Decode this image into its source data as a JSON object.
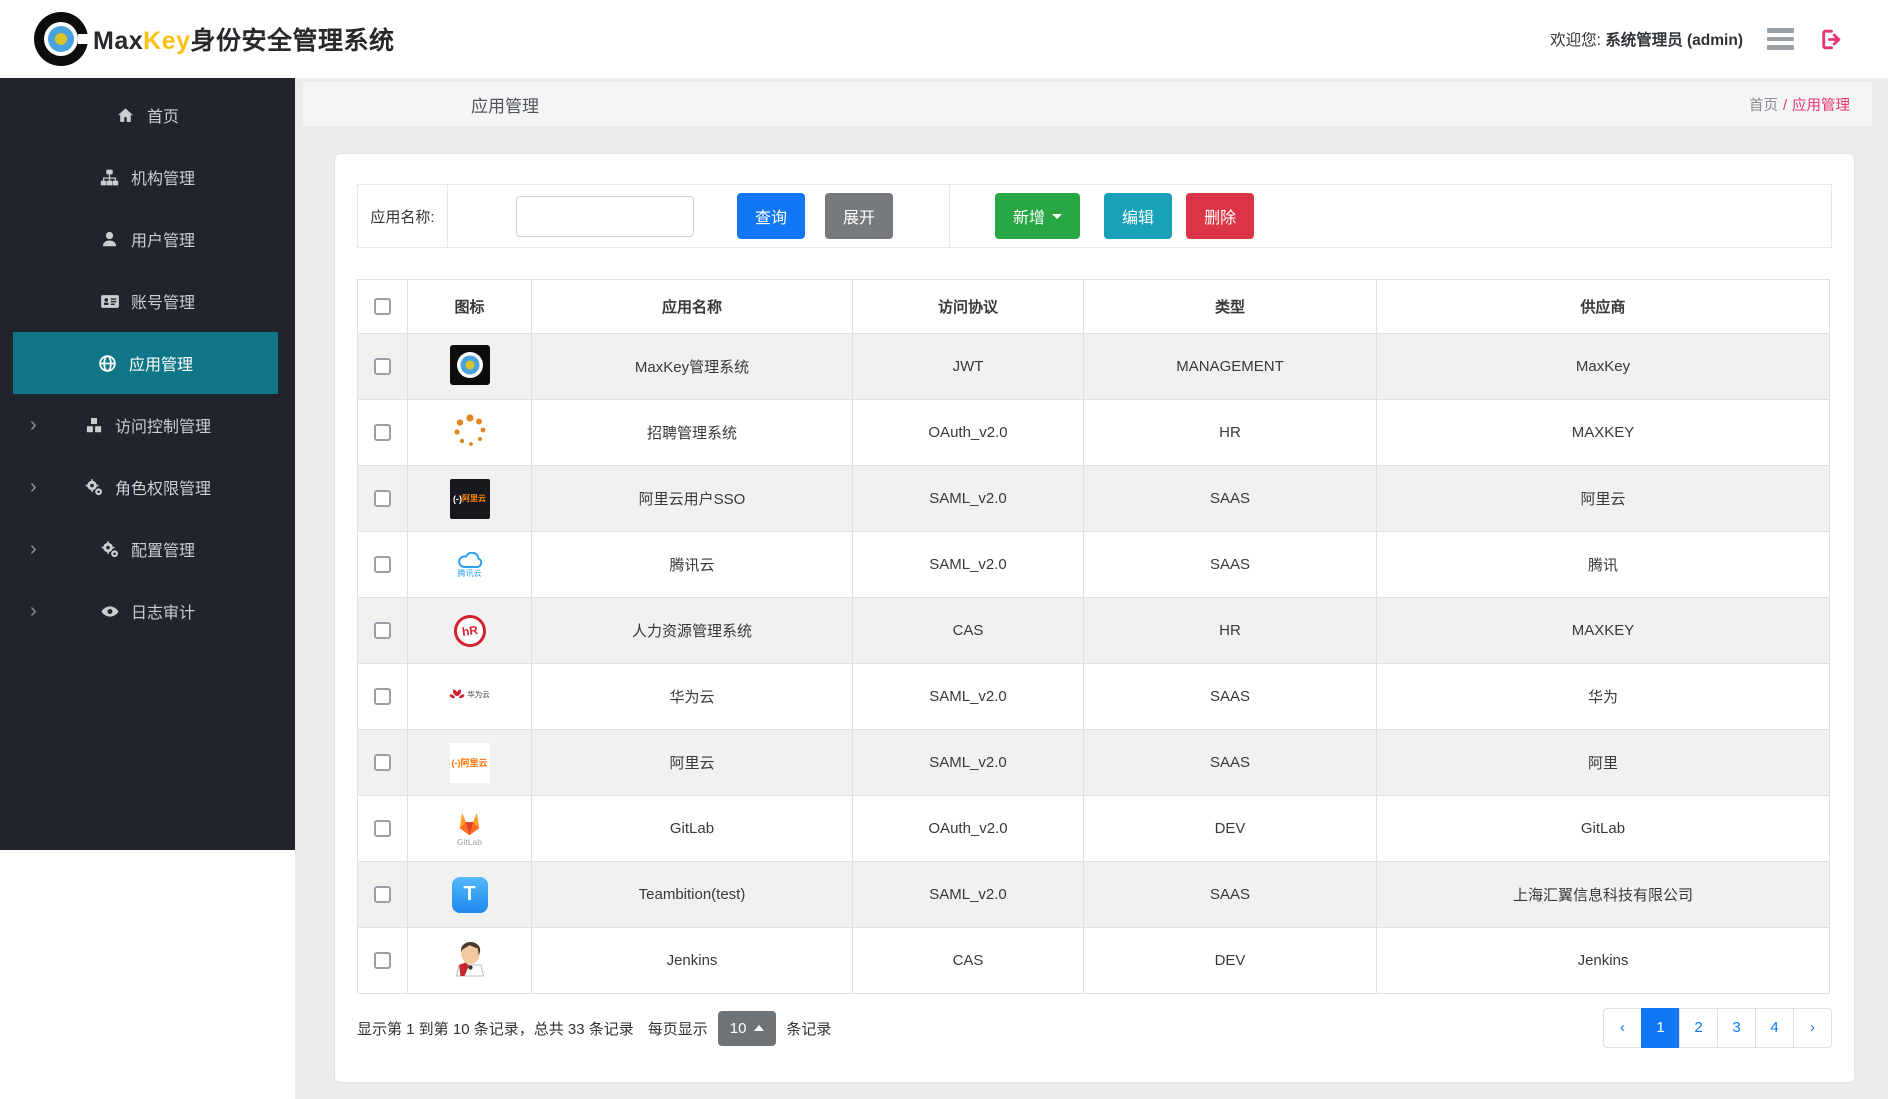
{
  "header": {
    "brand_prefix": "Max",
    "brand_accent": "Key",
    "brand_suffix": "身份安全管理系统",
    "welcome_label": "欢迎您:",
    "username": "系统管理员 (admin)"
  },
  "sidebar": {
    "items": [
      {
        "id": "home",
        "label": "首页",
        "icon": "home-icon",
        "active": false,
        "expandable": false
      },
      {
        "id": "org",
        "label": "机构管理",
        "icon": "sitemap-icon",
        "active": false,
        "expandable": false
      },
      {
        "id": "users",
        "label": "用户管理",
        "icon": "user-icon",
        "active": false,
        "expandable": false
      },
      {
        "id": "accounts",
        "label": "账号管理",
        "icon": "id-card-icon",
        "active": false,
        "expandable": false
      },
      {
        "id": "apps",
        "label": "应用管理",
        "icon": "globe-icon",
        "active": true,
        "expandable": false
      },
      {
        "id": "access-control",
        "label": "访问控制管理",
        "icon": "cubes-icon",
        "active": false,
        "expandable": true
      },
      {
        "id": "roles",
        "label": "角色权限管理",
        "icon": "gears-icon",
        "active": false,
        "expandable": true
      },
      {
        "id": "config",
        "label": "配置管理",
        "icon": "gears-icon",
        "active": false,
        "expandable": true
      },
      {
        "id": "audit",
        "label": "日志审计",
        "icon": "eye-icon",
        "active": false,
        "expandable": true
      }
    ]
  },
  "page": {
    "title": "应用管理",
    "breadcrumb": {
      "home": "首页",
      "separator": "/",
      "current": "应用管理"
    }
  },
  "toolbar": {
    "search_label": "应用名称:",
    "search_value": "",
    "query_label": "查询",
    "expand_label": "展开",
    "add_label": "新增",
    "edit_label": "编辑",
    "delete_label": "删除"
  },
  "table": {
    "columns": [
      "图标",
      "应用名称",
      "访问协议",
      "类型",
      "供应商"
    ],
    "rows": [
      {
        "icon": "maxkey-logo-icon",
        "name": "MaxKey管理系统",
        "protocol": "JWT",
        "type": "MANAGEMENT",
        "vendor": "MaxKey"
      },
      {
        "icon": "recruit-dots-icon",
        "name": "招聘管理系统",
        "protocol": "OAuth_v2.0",
        "type": "HR",
        "vendor": "MAXKEY"
      },
      {
        "icon": "aliyun-dark-icon",
        "name": "阿里云用户SSO",
        "protocol": "SAML_v2.0",
        "type": "SAAS",
        "vendor": "阿里云"
      },
      {
        "icon": "tencent-cloud-icon",
        "name": "腾讯云",
        "protocol": "SAML_v2.0",
        "type": "SAAS",
        "vendor": "腾讯"
      },
      {
        "icon": "hr-system-icon",
        "name": "人力资源管理系统",
        "protocol": "CAS",
        "type": "HR",
        "vendor": "MAXKEY"
      },
      {
        "icon": "huawei-cloud-icon",
        "name": "华为云",
        "protocol": "SAML_v2.0",
        "type": "SAAS",
        "vendor": "华为"
      },
      {
        "icon": "aliyun-orange-icon",
        "name": "阿里云",
        "protocol": "SAML_v2.0",
        "type": "SAAS",
        "vendor": "阿里"
      },
      {
        "icon": "gitlab-icon",
        "name": "GitLab",
        "protocol": "OAuth_v2.0",
        "type": "DEV",
        "vendor": "GitLab"
      },
      {
        "icon": "teambition-icon",
        "name": "Teambition(test)",
        "protocol": "SAML_v2.0",
        "type": "SAAS",
        "vendor": "上海汇翼信息科技有限公司"
      },
      {
        "icon": "jenkins-icon",
        "name": "Jenkins",
        "protocol": "CAS",
        "type": "DEV",
        "vendor": "Jenkins"
      }
    ]
  },
  "footer": {
    "summary": "显示第 1 到第 10 条记录，总共 33 条记录",
    "per_page_label": "每页显示",
    "page_size": "10",
    "per_page_suffix": "条记录",
    "pagination": [
      {
        "name": "pagination-prev",
        "label": "‹",
        "active": false
      },
      {
        "name": "pagination-page-1",
        "label": "1",
        "active": true
      },
      {
        "name": "pagination-page-2",
        "label": "2",
        "active": false
      },
      {
        "name": "pagination-page-3",
        "label": "3",
        "active": false
      },
      {
        "name": "pagination-page-4",
        "label": "4",
        "active": false
      },
      {
        "name": "pagination-next",
        "label": "›",
        "active": false
      }
    ]
  },
  "colors": {
    "sidebar_bg": "#20252b",
    "sidebar_active_teal": "#0f7687",
    "brand_gold": "#fdc116",
    "breadcrumb_pink": "#e7356f",
    "primary_blue": "#1277f5",
    "secondary_gray": "#76797e",
    "success_green": "#28a745",
    "info_teal": "#17a2b8",
    "danger_red": "#dc3545"
  }
}
